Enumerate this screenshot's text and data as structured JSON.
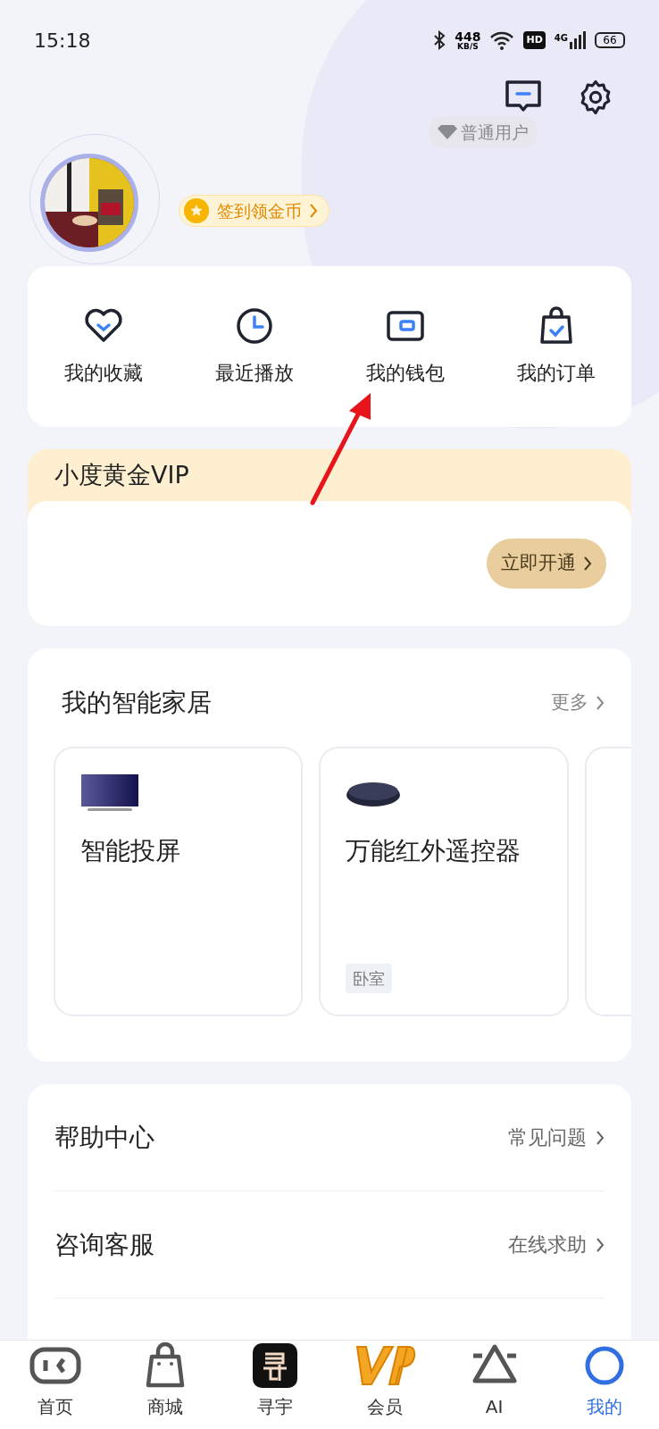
{
  "status_bar": {
    "time": "15:18",
    "speed": "448",
    "speed_unit": "KB/S",
    "hd": "HD",
    "network": "4G",
    "battery": "66"
  },
  "profile": {
    "user_level": "普通用户",
    "checkin": "签到领金币"
  },
  "shortcuts": [
    {
      "label": "我的收藏",
      "kind": "heart"
    },
    {
      "label": "最近播放",
      "kind": "clock"
    },
    {
      "label": "我的钱包",
      "kind": "wallet"
    },
    {
      "label": "我的订单",
      "kind": "bag"
    }
  ],
  "vip": {
    "title": "小度黄金VIP",
    "button": "立即开通"
  },
  "smart_home": {
    "title": "我的智能家居",
    "more": "更多",
    "devices": [
      {
        "name": "智能投屏",
        "kind": "tv"
      },
      {
        "name": "万能红外遥控器",
        "kind": "remote",
        "room": "卧室"
      }
    ]
  },
  "help": [
    {
      "label": "帮助中心",
      "link": "常见问题"
    },
    {
      "label": "咨询客服",
      "link": "在线求助"
    }
  ],
  "nav": [
    {
      "label": "首页",
      "kind": "home",
      "selected": false
    },
    {
      "label": "商城",
      "kind": "shop",
      "selected": false
    },
    {
      "label": "寻宇",
      "kind": "xun",
      "selected": false
    },
    {
      "label": "会员",
      "kind": "vip",
      "selected": false
    },
    {
      "label": "AI",
      "kind": "ai",
      "selected": false
    },
    {
      "label": "我的",
      "kind": "me",
      "selected": true
    }
  ]
}
